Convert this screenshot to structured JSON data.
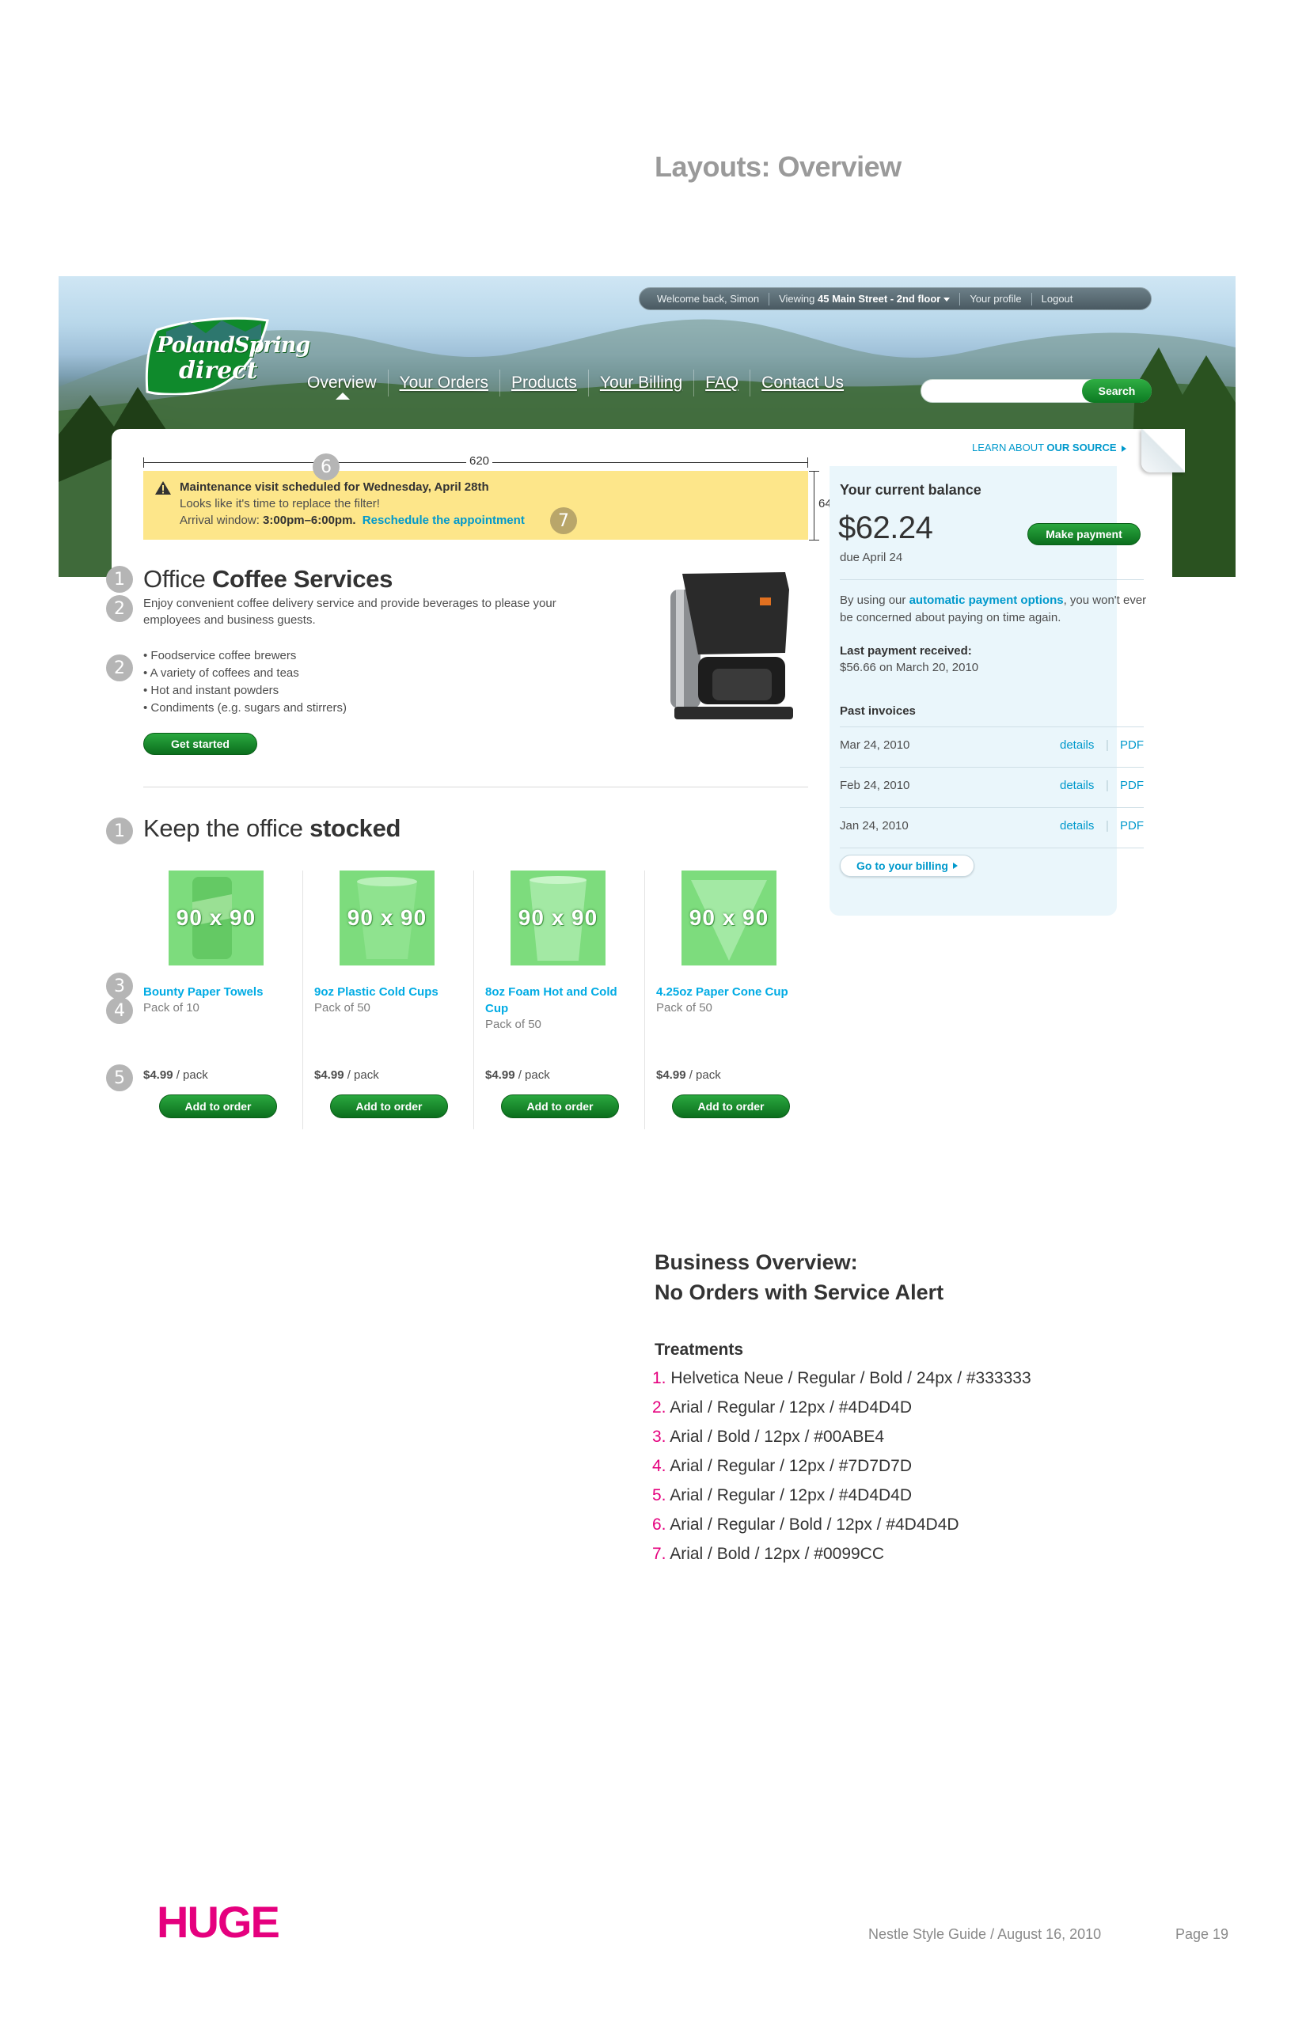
{
  "page_title": "Layouts: Overview",
  "topbar": {
    "welcome": "Welcome back, Simon",
    "viewing_prefix": "Viewing",
    "viewing_location": "45 Main Street - 2nd floor",
    "profile": "Your profile",
    "logout": "Logout"
  },
  "logo": {
    "line1": "PolandSpring",
    "line2": "direct"
  },
  "nav": {
    "items": [
      "Overview",
      "Your Orders",
      "Products",
      "Your Billing",
      "FAQ",
      "Contact Us"
    ],
    "active": "Overview"
  },
  "search": {
    "placeholder": "",
    "button": "Search"
  },
  "learn_link": {
    "prefix": "LEARN ABOUT",
    "bold": "OUR SOURCE"
  },
  "dimensions": {
    "width_label": "620",
    "height_label": "64"
  },
  "alert": {
    "title": "Maintenance visit scheduled for Wednesday, April 28th",
    "line2": "Looks like it's time to replace the filter!",
    "window_prefix": "Arrival window:",
    "window_time": "3:00pm–6:00pm.",
    "reschedule": "Reschedule the appointment"
  },
  "markers": {
    "m1": "1",
    "m2": "2",
    "m3": "3",
    "m4": "4",
    "m5": "5",
    "m6": "6",
    "m7": "7"
  },
  "office": {
    "title_light": "Office",
    "title_bold": "Coffee Services",
    "desc": "Enjoy convenient coffee delivery service and provide beverages to please your employees and business guests.",
    "bullets": [
      "• Foodservice coffee brewers",
      "• A variety of coffees and teas",
      "• Hot and instant powders",
      "• Condiments (e.g. sugars and stirrers)"
    ],
    "cta": "Get started"
  },
  "stock": {
    "title_light": "Keep the office",
    "title_bold": "stocked",
    "products": [
      {
        "thumb": "90 x 90",
        "name": "Bounty Paper Towels",
        "pack": "Pack of 10",
        "price": "$4.99",
        "unit": "/ pack",
        "button": "Add to order"
      },
      {
        "thumb": "90 x 90",
        "name": "9oz Plastic Cold Cups",
        "pack": "Pack of 50",
        "price": "$4.99",
        "unit": "/ pack",
        "button": "Add to order"
      },
      {
        "thumb": "90 x 90",
        "name": "8oz Foam Hot and Cold Cup",
        "pack": "Pack of 50",
        "price": "$4.99",
        "unit": "/ pack",
        "button": "Add to order"
      },
      {
        "thumb": "90 x 90",
        "name": "4.25oz Paper Cone Cup",
        "pack": "Pack of 50",
        "price": "$4.99",
        "unit": "/ pack",
        "button": "Add to order"
      }
    ]
  },
  "balance": {
    "title": "Your current balance",
    "amount": "$62.24",
    "due": "due April 24",
    "pay_button": "Make payment",
    "auto_prefix": "By using our",
    "auto_link": "automatic payment options",
    "auto_suffix": ", you won't ever be concerned about paying on time again.",
    "last_label": "Last payment received:",
    "last_value": "$56.66 on March 20, 2010",
    "invoices_title": "Past invoices",
    "invoices": [
      {
        "date": "Mar 24, 2010",
        "details": "details",
        "sep": "|",
        "pdf": "PDF"
      },
      {
        "date": "Feb 24, 2010",
        "details": "details",
        "sep": "|",
        "pdf": "PDF"
      },
      {
        "date": "Jan 24, 2010",
        "details": "details",
        "sep": "|",
        "pdf": "PDF"
      }
    ],
    "billing_button": "Go to your billing"
  },
  "notes": {
    "title_line1": "Business Overview:",
    "title_line2": "No Orders with Service Alert",
    "treatments_title": "Treatments",
    "treatments": [
      {
        "num": "1.",
        "text": " Helvetica Neue / Regular / Bold /  24px / #333333"
      },
      {
        "num": "2.",
        "text": " Arial / Regular / 12px / #4D4D4D"
      },
      {
        "num": "3.",
        "text": " Arial / Bold / 12px /  #00ABE4"
      },
      {
        "num": "4.",
        "text": " Arial / Regular / 12px / #7D7D7D"
      },
      {
        "num": "5.",
        "text": " Arial / Regular / 12px / #4D4D4D"
      },
      {
        "num": "6.",
        "text": " Arial / Regular / Bold / 12px / #4D4D4D"
      },
      {
        "num": "7.",
        "text": " Arial / Bold / 12px / #0099CC"
      }
    ]
  },
  "footer": {
    "brand": "HUGE",
    "guide": "Nestle Style Guide / August 16, 2010",
    "page": "Page 19"
  },
  "colors": {
    "brand_pink": "#e5007e",
    "heading": "#333333",
    "body": "#4d4d4d",
    "product_name": "#00abe4",
    "muted": "#7d7d7d",
    "link": "#0099cc",
    "alert_bg": "#fde68a",
    "button_green": "#0b7a22",
    "balance_bg": "#eaf6fb"
  }
}
